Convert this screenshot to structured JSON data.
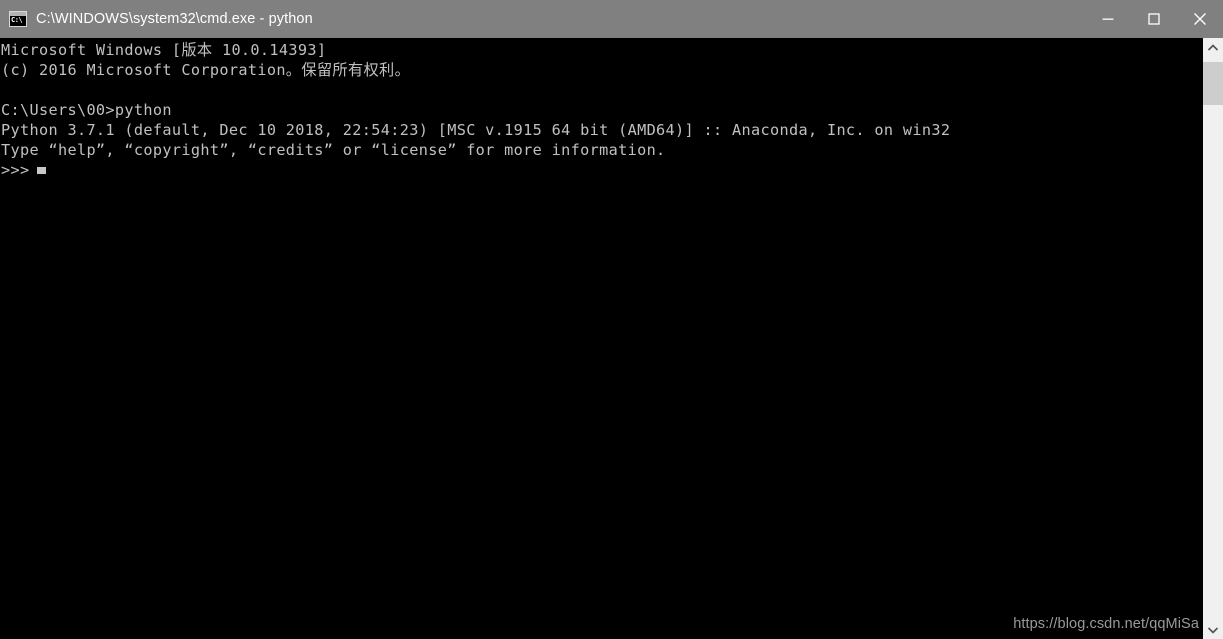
{
  "window": {
    "title": "C:\\WINDOWS\\system32\\cmd.exe - python",
    "icon_label": "C:\\",
    "titlebar_color": "#808080",
    "background_color": "#000000",
    "text_color": "#c0c0c0"
  },
  "titlebar_buttons": {
    "minimize": "minimize",
    "maximize": "maximize",
    "close": "close"
  },
  "console": {
    "lines": [
      "Microsoft Windows [版本 10.0.14393]",
      "(c) 2016 Microsoft Corporation。保留所有权利。",
      "",
      "C:\\Users\\00>python",
      "Python 3.7.1 (default, Dec 10 2018, 22:54:23) [MSC v.1915 64 bit (AMD64)] :: Anaconda, Inc. on win32",
      "Type “help”, “copyright”, “credits” or “license” for more information."
    ],
    "prompt": ">>>",
    "cursor": "block-cursor"
  },
  "watermark": {
    "text": "https://blog.csdn.net/qqMiSa"
  },
  "scrollbar": {
    "up_arrow": "chevron-up-icon",
    "down_arrow": "chevron-down-icon",
    "thumb": "scrollbar-thumb"
  }
}
